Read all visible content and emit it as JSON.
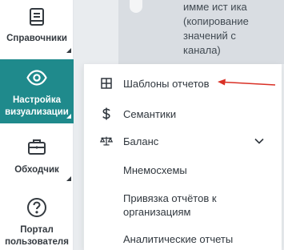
{
  "sidebar": {
    "items": [
      {
        "label": "Справочники",
        "icon": "book-icon"
      },
      {
        "label": "Настройка визуализации",
        "icon": "eye-icon",
        "active": true
      },
      {
        "label": "Обходчик",
        "icon": "briefcase-icon"
      },
      {
        "label": "Портал пользователя",
        "icon": "help-circle-icon"
      }
    ],
    "active_color": "#1f8a8c"
  },
  "background": {
    "text": "имме ист ика\n(копирование\nзначений с\nканала)"
  },
  "menu": {
    "items": [
      {
        "label": "Шаблоны отчетов",
        "icon": "grid-icon"
      },
      {
        "label": "Семантики",
        "icon": "dollar-icon"
      },
      {
        "label": "Баланс",
        "icon": "scale-icon",
        "expandable": true
      },
      {
        "label": "Мнемосхемы"
      },
      {
        "label": "Привязка отчётов к организациям"
      },
      {
        "label": "Аналитические отчеты"
      }
    ]
  },
  "annotation": {
    "color": "#d93025"
  }
}
